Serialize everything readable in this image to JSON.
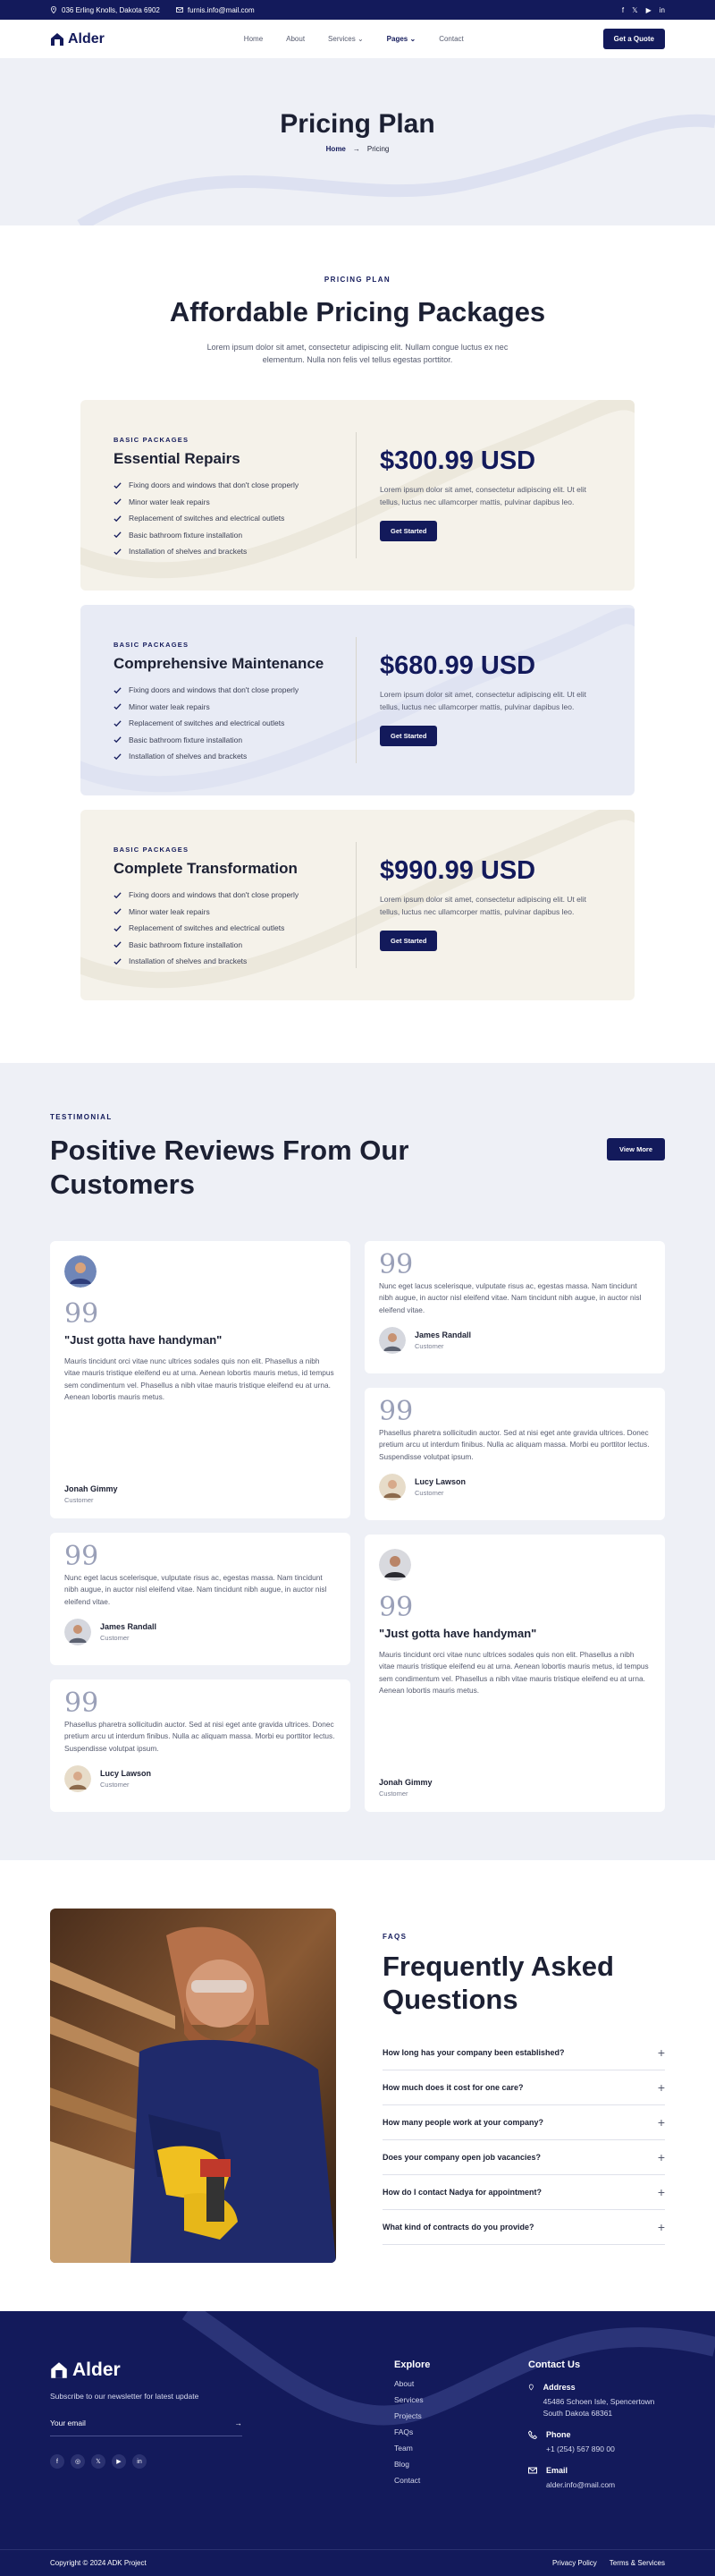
{
  "topbar": {
    "address": "036 Erling Knolls, Dakota 6902",
    "email": "furnis.info@mail.com",
    "socials": [
      "facebook-icon",
      "twitter-icon",
      "youtube-icon",
      "linkedin-icon"
    ]
  },
  "header": {
    "brand": "Alder",
    "nav": [
      "Home",
      "About",
      "Services",
      "Pages",
      "Contact"
    ],
    "cta": "Get a Quote"
  },
  "hero": {
    "title": "Pricing Plan",
    "crumb_home": "Home",
    "crumb_current": "Pricing"
  },
  "pricing": {
    "eyebrow": "PRICING PLAN",
    "title": "Affordable Pricing Packages",
    "subtitle": "Lorem ipsum dolor sit amet, consectetur adipiscing elit. Nullam congue luctus ex nec elementum. Nulla non felis vel tellus egestas porttitor.",
    "plans": [
      {
        "tag": "BASIC PACKAGES",
        "name": "Essential Repairs",
        "features": [
          "Fixing doors and windows that don't close properly",
          "Minor water leak repairs",
          "Replacement of switches and electrical outlets",
          "Basic bathroom fixture installation",
          "Installation of shelves and brackets"
        ],
        "price": "$300.99 USD",
        "desc": "Lorem ipsum dolor sit amet, consectetur adipiscing elit. Ut elit tellus, luctus nec ullamcorper mattis, pulvinar dapibus leo.",
        "button": "Get Started"
      },
      {
        "tag": "BASIC PACKAGES",
        "name": "Comprehensive Maintenance",
        "features": [
          "Fixing doors and windows that don't close properly",
          "Minor water leak repairs",
          "Replacement of switches and electrical outlets",
          "Basic bathroom fixture installation",
          "Installation of shelves and brackets"
        ],
        "price": "$680.99 USD",
        "desc": "Lorem ipsum dolor sit amet, consectetur adipiscing elit. Ut elit tellus, luctus nec ullamcorper mattis, pulvinar dapibus leo.",
        "button": "Get Started"
      },
      {
        "tag": "BASIC PACKAGES",
        "name": "Complete Transformation",
        "features": [
          "Fixing doors and windows that don't close properly",
          "Minor water leak repairs",
          "Replacement of switches and electrical outlets",
          "Basic bathroom fixture installation",
          "Installation of shelves and brackets"
        ],
        "price": "$990.99 USD",
        "desc": "Lorem ipsum dolor sit amet, consectetur adipiscing elit. Ut elit tellus, luctus nec ullamcorper mattis, pulvinar dapibus leo.",
        "button": "Get Started"
      }
    ]
  },
  "testimonials": {
    "eyebrow": "TESTIMONIAL",
    "title": "Positive Reviews From Our Customers",
    "button": "View More",
    "long": {
      "title": "\"Just gotta have handyman\"",
      "text": "Mauris tincidunt orci vitae nunc ultrices sodales quis non elit. Phasellus a nibh vitae mauris tristique eleifend eu at urna. Aenean lobortis mauris metus, id tempus sem condimentum vel. Phasellus a nibh vitae mauris tristique eleifend eu at urna. Aenean lobortis mauris metus.",
      "name": "Jonah Gimmy",
      "role": "Customer"
    },
    "short_james": {
      "text": "Nunc eget lacus scelerisque, vulputate risus ac, egestas massa. Nam tincidunt nibh augue, in auctor nisl eleifend vitae. Nam tincidunt nibh augue, in auctor nisl eleifend vitae.",
      "name": "James Randall",
      "role": "Customer"
    },
    "short_lucy": {
      "text": "Phasellus pharetra sollicitudin auctor. Sed at nisi eget ante gravida ultrices. Donec pretium arcu ut interdum finibus. Nulla ac aliquam massa. Morbi eu porttitor lectus. Suspendisse volutpat ipsum.",
      "name": "Lucy Lawson",
      "role": "Customer"
    },
    "quote_glyph": "99"
  },
  "faq": {
    "eyebrow": "FAQS",
    "title": "Frequently Asked Questions",
    "items": [
      "How long has your company been established?",
      "How much does it cost for one care?",
      "How many people work at your company?",
      "Does your company open job vacancies?",
      "How do I contact Nadya for appointment?",
      "What kind of contracts do you provide?"
    ]
  },
  "footer": {
    "brand": "Alder",
    "subscribe": "Subscribe to our newsletter for latest update",
    "email_placeholder": "Your email",
    "explore_title": "Explore",
    "explore": [
      "About",
      "Services",
      "Projects",
      "FAQs",
      "Team",
      "Blog",
      "Contact"
    ],
    "contact_title": "Contact Us",
    "address_label": "Address",
    "address": "45486 Schoen Isle, Spencertown South Dakota 68361",
    "phone_label": "Phone",
    "phone": "+1 (254) 567 890 00",
    "email_label": "Email",
    "email": "alder.info@mail.com",
    "copyright": "Copyright © 2024 ADK Project",
    "privacy": "Privacy Policy",
    "terms": "Terms & Services"
  },
  "colors": {
    "navy": "#131a5b",
    "beige": "#f5f2ea",
    "lavender": "#e8ebf5",
    "light": "#eef0f6"
  }
}
